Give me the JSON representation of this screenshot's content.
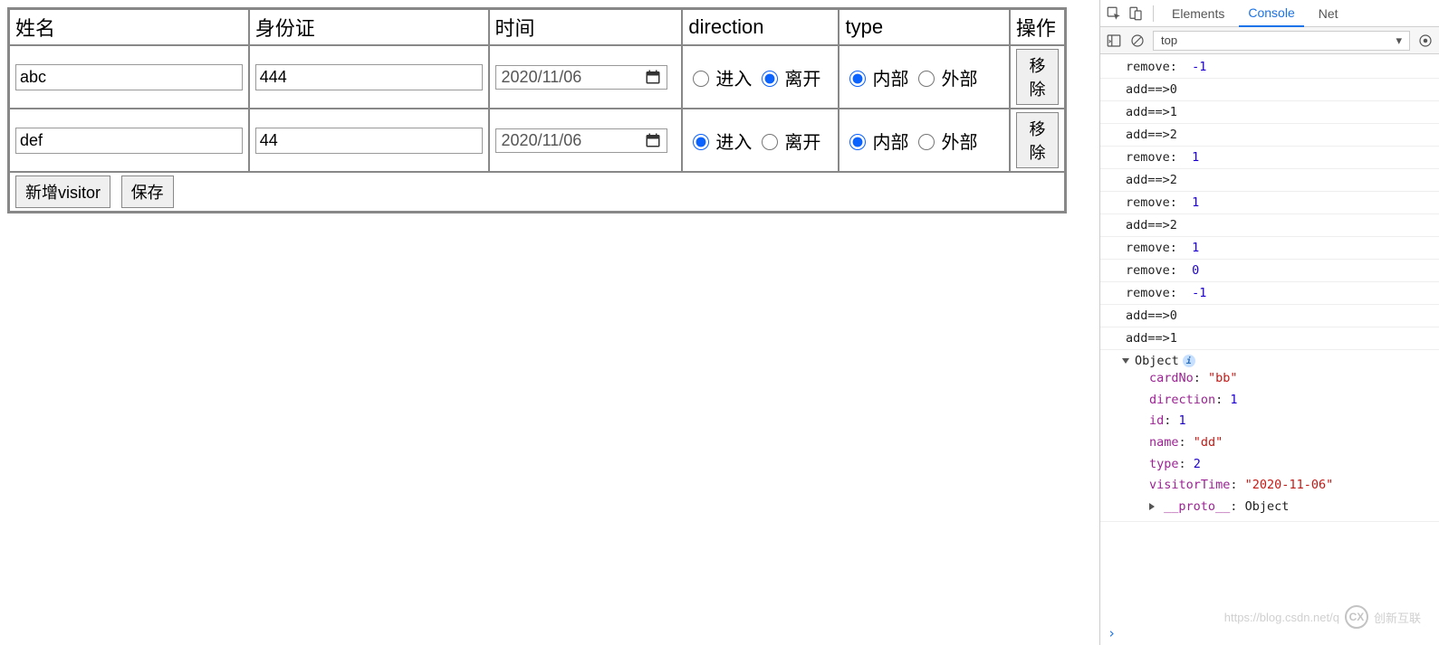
{
  "table": {
    "headers": {
      "name": "姓名",
      "card": "身份证",
      "time": "时间",
      "direction": "direction",
      "type": "type",
      "op": "操作"
    },
    "direction_labels": {
      "in": "进入",
      "out": "离开"
    },
    "type_labels": {
      "internal": "内部",
      "external": "外部"
    },
    "remove_label": "移除",
    "rows": [
      {
        "name": "abc",
        "card": "444",
        "time": "2020/11/06",
        "direction": "out",
        "type": "internal"
      },
      {
        "name": "def",
        "card": "44",
        "time": "2020/11/06",
        "direction": "in",
        "type": "internal"
      }
    ],
    "footer": {
      "add": "新增visitor",
      "save": "保存"
    }
  },
  "devtools": {
    "tabs": {
      "elements": "Elements",
      "console": "Console",
      "net": "Net"
    },
    "scope": "top",
    "logs": [
      {
        "text": "remove:  ",
        "num": "-1"
      },
      {
        "text": "add==>0"
      },
      {
        "text": "add==>1"
      },
      {
        "text": "add==>2"
      },
      {
        "text": "remove:  ",
        "num": "1"
      },
      {
        "text": "add==>2"
      },
      {
        "text": "remove:  ",
        "num": "1"
      },
      {
        "text": "add==>2"
      },
      {
        "text": "remove:  ",
        "num": "1"
      },
      {
        "text": "remove:  ",
        "num": "0"
      },
      {
        "text": "remove:  ",
        "num": "-1"
      },
      {
        "text": "add==>0"
      },
      {
        "text": "add==>1"
      }
    ],
    "object": {
      "header": "Object",
      "props": [
        {
          "k": "cardNo",
          "v": "\"bb\"",
          "t": "str"
        },
        {
          "k": "direction",
          "v": "1",
          "t": "num"
        },
        {
          "k": "id",
          "v": "1",
          "t": "num"
        },
        {
          "k": "name",
          "v": "\"dd\"",
          "t": "str"
        },
        {
          "k": "type",
          "v": "2",
          "t": "num"
        },
        {
          "k": "visitorTime",
          "v": "\"2020-11-06\"",
          "t": "str"
        }
      ],
      "proto": "__proto__",
      "proto_val": "Object"
    }
  },
  "watermark": {
    "brand": "创新互联",
    "url": "https://blog.csdn.net/q"
  }
}
